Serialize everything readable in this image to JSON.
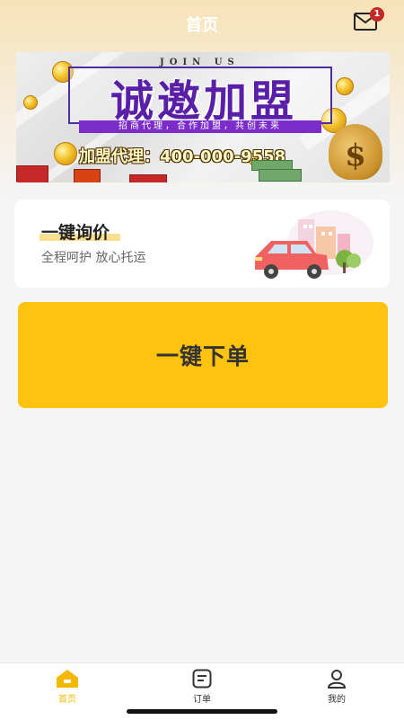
{
  "header": {
    "title": "首页",
    "mail_badge_count": "1"
  },
  "banner": {
    "tagline_en": "JOIN US",
    "headline": "诚邀加盟",
    "subline": "招商代理，合作加盟，共创未来",
    "hotline": "加盟代理：400-000-9558"
  },
  "quote_card": {
    "title": "一键询价",
    "subtitle": "全程呵护 放心托运"
  },
  "order_button": {
    "label": "一键下单"
  },
  "tabbar": {
    "items": [
      {
        "label": "首页",
        "icon": "home-icon",
        "active": true
      },
      {
        "label": "订单",
        "icon": "order-list-icon",
        "active": false
      },
      {
        "label": "我的",
        "icon": "profile-icon",
        "active": false
      }
    ]
  },
  "colors": {
    "accent": "#ffc20e",
    "tab_active": "#f5b800",
    "badge": "#c62828",
    "headline_purple": "#5a1fa8"
  }
}
